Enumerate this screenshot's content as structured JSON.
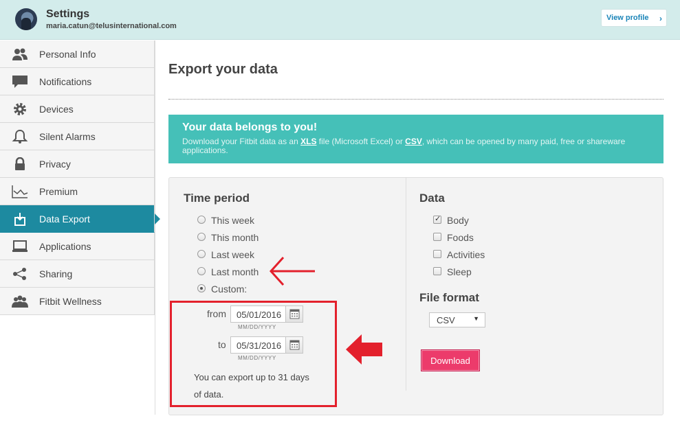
{
  "header": {
    "title": "Settings",
    "email": "maria.catun@telusinternational.com",
    "view_profile": "View profile"
  },
  "sidebar": {
    "items": [
      {
        "label": "Personal Info",
        "icon": "people-icon"
      },
      {
        "label": "Notifications",
        "icon": "chat-bubble-icon"
      },
      {
        "label": "Devices",
        "icon": "gear-icon"
      },
      {
        "label": "Silent Alarms",
        "icon": "bell-icon"
      },
      {
        "label": "Privacy",
        "icon": "lock-icon"
      },
      {
        "label": "Premium",
        "icon": "line-chart-icon"
      },
      {
        "label": "Data Export",
        "icon": "export-icon",
        "active": true
      },
      {
        "label": "Applications",
        "icon": "laptop-icon"
      },
      {
        "label": "Sharing",
        "icon": "share-icon"
      },
      {
        "label": "Fitbit Wellness",
        "icon": "group-icon"
      }
    ]
  },
  "main": {
    "title": "Export your data",
    "banner": {
      "title": "Your data belongs to you!",
      "text_1": "Download your Fitbit data as an ",
      "xls": "XLS",
      "text_2": " file (Microsoft Excel) or ",
      "csv": "CSV",
      "text_3": ", which can be opened by many paid, free or shareware applications."
    },
    "time_period": {
      "title": "Time period",
      "options": [
        "This week",
        "This month",
        "Last week",
        "Last month",
        "Custom:"
      ],
      "selected": "Custom:",
      "from_label": "from",
      "from_value": "05/01/2016",
      "to_label": "to",
      "to_value": "05/31/2016",
      "date_hint": "MM/DD/YYYY",
      "note": "You can export up to 31 days of data."
    },
    "data": {
      "title": "Data",
      "options": [
        {
          "label": "Body",
          "checked": true
        },
        {
          "label": "Foods",
          "checked": false
        },
        {
          "label": "Activities",
          "checked": false
        },
        {
          "label": "Sleep",
          "checked": false
        }
      ]
    },
    "file_format": {
      "title": "File format",
      "selected": "CSV"
    },
    "download_label": "Download"
  },
  "colors": {
    "header_bg": "#d3eceb",
    "active_nav": "#1d8aa0",
    "banner_bg": "#45c0b8",
    "download_bg": "#ec3b6b",
    "annotation_red": "#e3202c"
  }
}
